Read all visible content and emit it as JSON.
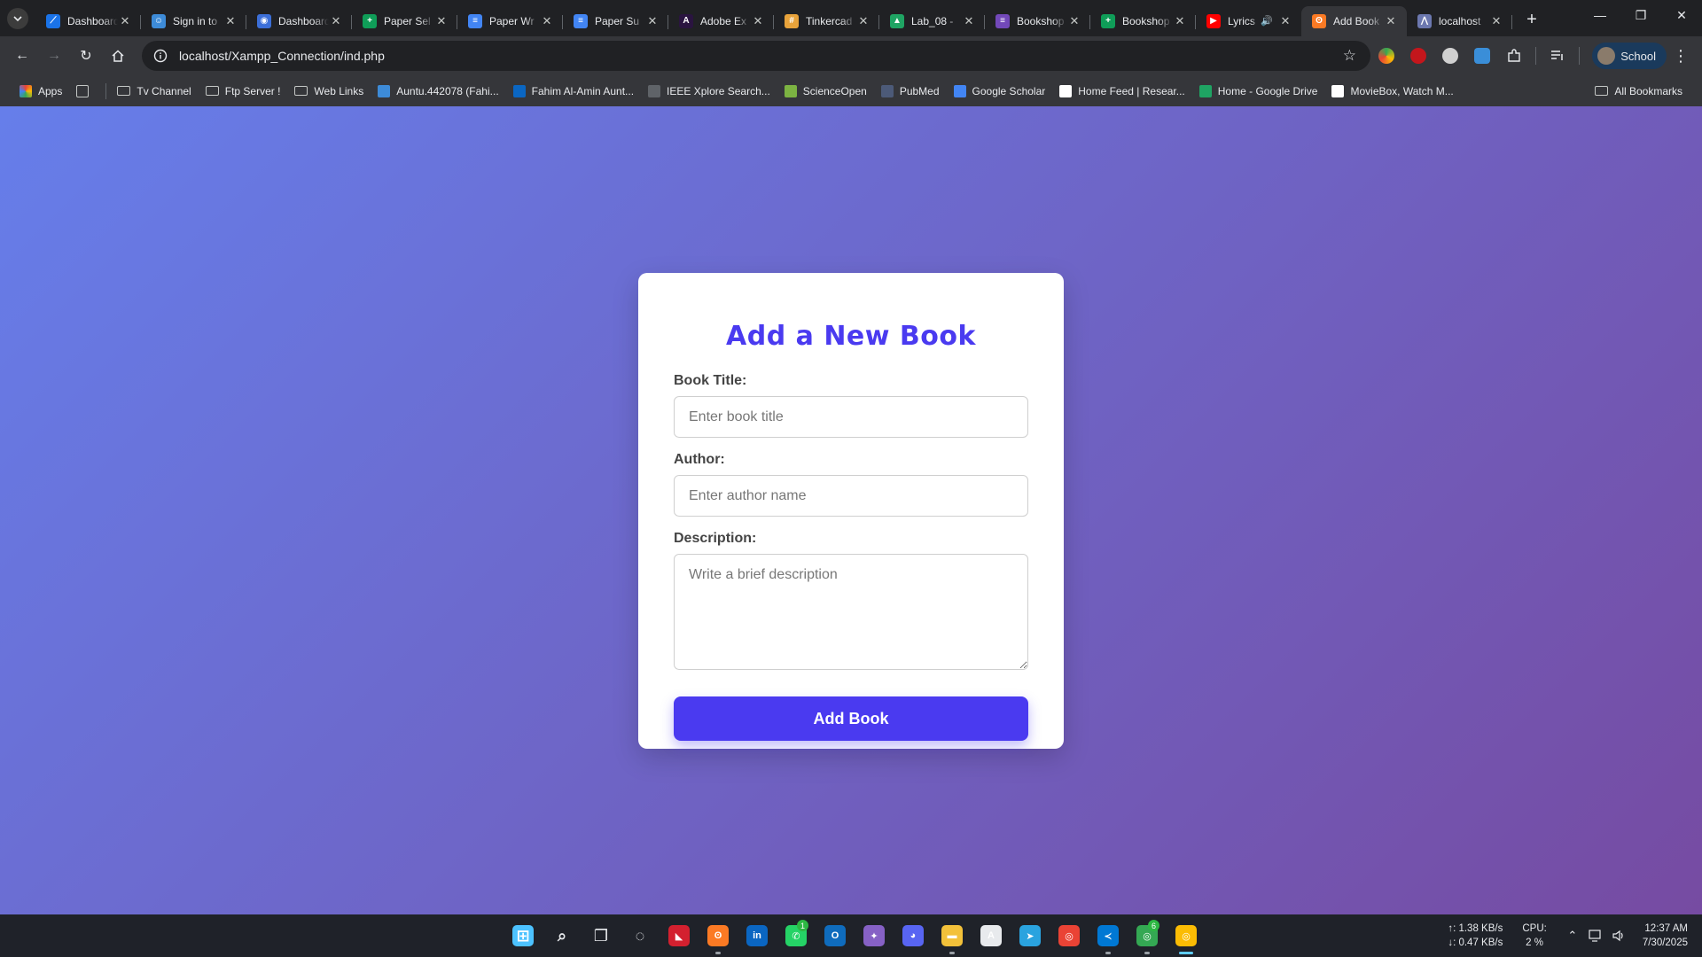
{
  "browser": {
    "tabs": [
      {
        "title": "Dashboard",
        "favicon": "dashboard-icon",
        "color": "#1a73e8",
        "glyph": "⟋"
      },
      {
        "title": "Sign in to",
        "favicon": "sign-in-icon",
        "color": "#3d8bd8",
        "glyph": "☺"
      },
      {
        "title": "Dashboard",
        "favicon": "dashboard-icon",
        "color": "#3c6fd8",
        "glyph": "◉"
      },
      {
        "title": "Paper Sel",
        "favicon": "sheets-icon",
        "color": "#0f9d58",
        "glyph": "+"
      },
      {
        "title": "Paper Wr",
        "favicon": "docs-icon",
        "color": "#4285f4",
        "glyph": "≡"
      },
      {
        "title": "Paper Su",
        "favicon": "docs-icon",
        "color": "#4285f4",
        "glyph": "≡"
      },
      {
        "title": "Adobe Ex",
        "favicon": "adobe-express-icon",
        "color": "#2a1440",
        "glyph": "A"
      },
      {
        "title": "Tinkercad",
        "favicon": "tinkercad-icon",
        "color": "#e8a33b",
        "glyph": "#"
      },
      {
        "title": "Lab_08 -",
        "favicon": "drive-icon",
        "color": "#1fa463",
        "glyph": "▲"
      },
      {
        "title": "Bookshop",
        "favicon": "forms-icon",
        "color": "#7248b9",
        "glyph": "≡"
      },
      {
        "title": "Bookshop",
        "favicon": "sheets-icon",
        "color": "#0f9d58",
        "glyph": "+"
      },
      {
        "title": "Lyrics",
        "favicon": "youtube-icon",
        "color": "#ff0000",
        "glyph": "▶"
      },
      {
        "title": "Add Book",
        "favicon": "xampp-icon",
        "color": "#fb7a24",
        "glyph": "ʘ"
      },
      {
        "title": "localhost",
        "favicon": "phpmyadmin-icon",
        "color": "#6c78af",
        "glyph": "⋀"
      }
    ],
    "active_tab_index": 12,
    "audio_tab_index": 11,
    "address_bar": {
      "url": "localhost/Xampp_Connection/ind.php"
    },
    "profile_label": "School",
    "bookmarks": [
      {
        "label": "Apps",
        "icon": "apps-grid-icon",
        "color": "#ea4335"
      },
      {
        "label": "",
        "icon": "tab-groups-icon",
        "color": "#9aa0a6"
      },
      {
        "label": "Tv Channel",
        "icon": "folder-icon",
        "color": ""
      },
      {
        "label": "Ftp Server !",
        "icon": "folder-icon",
        "color": ""
      },
      {
        "label": "Web Links",
        "icon": "folder-icon",
        "color": ""
      },
      {
        "label": "Auntu.442078 (Fahi...",
        "icon": "vjudge-icon",
        "color": "#3d8bd8"
      },
      {
        "label": "Fahim Al-Amin Aunt...",
        "icon": "linkedin-icon",
        "color": "#0a66c2"
      },
      {
        "label": "IEEE Xplore Search...",
        "icon": "ieee-icon",
        "color": "#5f6368"
      },
      {
        "label": "ScienceOpen",
        "icon": "scienceopen-icon",
        "color": "#7cb342"
      },
      {
        "label": "PubMed",
        "icon": "pubmed-icon",
        "color": "#4c5a78"
      },
      {
        "label": "Google Scholar",
        "icon": "scholar-icon",
        "color": "#4285f4"
      },
      {
        "label": "Home Feed | Resear...",
        "icon": "researchgate-icon",
        "color": "#ffffff"
      },
      {
        "label": "Home - Google Drive",
        "icon": "drive-icon",
        "color": "#1fa463"
      },
      {
        "label": "MovieBox, Watch M...",
        "icon": "moviebox-icon",
        "color": "#ffffff"
      }
    ],
    "all_bookmarks_label": "All Bookmarks"
  },
  "page": {
    "heading": "Add a New Book",
    "form": {
      "title_label": "Book Title:",
      "title_placeholder": "Enter book title",
      "author_label": "Author:",
      "author_placeholder": "Enter author name",
      "description_label": "Description:",
      "description_placeholder": "Write a brief description",
      "submit_label": "Add Book"
    },
    "colors": {
      "accent": "#4a3af0",
      "gradient_start": "#667eea",
      "gradient_end": "#764ba2"
    }
  },
  "taskbar": {
    "apps": [
      {
        "name": "start-icon",
        "color": "#4cc2ff",
        "glyph": "⊞",
        "state": ""
      },
      {
        "name": "search-icon",
        "color": "transparent",
        "glyph": "⌕",
        "state": ""
      },
      {
        "name": "task-view-icon",
        "color": "transparent",
        "glyph": "❐",
        "state": ""
      },
      {
        "name": "widgets-icon",
        "color": "transparent",
        "glyph": "◌",
        "state": ""
      },
      {
        "name": "amd-icon",
        "color": "#d3202f",
        "glyph": "◣",
        "state": ""
      },
      {
        "name": "xampp-icon",
        "color": "#fb7a24",
        "glyph": "ʘ",
        "state": "open"
      },
      {
        "name": "linkedin-icon",
        "color": "#0a66c2",
        "glyph": "in",
        "state": ""
      },
      {
        "name": "whatsapp-icon",
        "color": "#25d366",
        "glyph": "✆",
        "state": "",
        "badge": "1"
      },
      {
        "name": "outlook-icon",
        "color": "#0f6cbd",
        "glyph": "O",
        "state": ""
      },
      {
        "name": "copilot-icon",
        "color": "#8661c5",
        "glyph": "✦",
        "state": ""
      },
      {
        "name": "discord-icon",
        "color": "#5865f2",
        "glyph": "◕",
        "state": ""
      },
      {
        "name": "file-explorer-icon",
        "color": "#f3c13a",
        "glyph": "▬",
        "state": "open"
      },
      {
        "name": "app-store-icon",
        "color": "#e8eaed",
        "glyph": "A",
        "state": ""
      },
      {
        "name": "telegram-icon",
        "color": "#2aa3df",
        "glyph": "➤",
        "state": ""
      },
      {
        "name": "chrome-icon",
        "color": "#ea4335",
        "glyph": "◎",
        "state": ""
      },
      {
        "name": "vscode-icon",
        "color": "#0078d4",
        "glyph": "≺",
        "state": "open"
      },
      {
        "name": "chrome-profile-icon",
        "color": "#34a853",
        "glyph": "◎",
        "state": "open",
        "badge": "6"
      },
      {
        "name": "chrome-active-icon",
        "color": "#fbbc04",
        "glyph": "◎",
        "state": "active"
      }
    ],
    "network_up": "↑: 1.38 KB/s",
    "network_down": "↓: 0.47 KB/s",
    "cpu_label": "CPU:",
    "cpu_value": "2 %",
    "time": "12:37 AM",
    "date": "7/30/2025"
  }
}
